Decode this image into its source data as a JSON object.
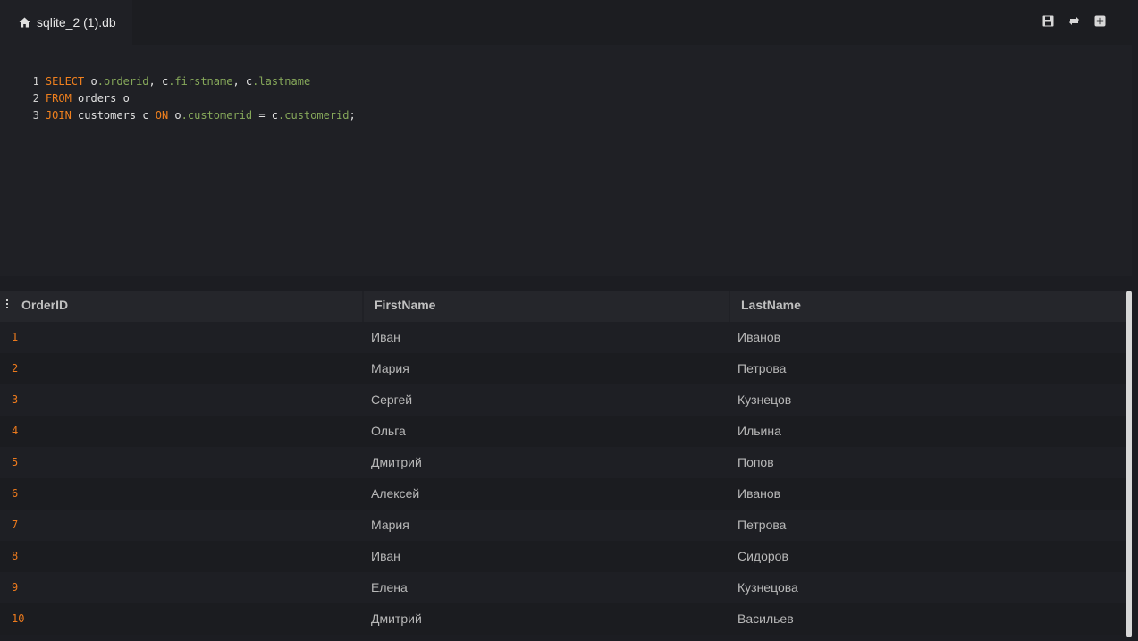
{
  "tab": {
    "label": "sqlite_2 (1).db",
    "icon": "home-icon"
  },
  "toolbar": {
    "icons": [
      "save-icon",
      "refresh-icon",
      "add-tab-icon"
    ]
  },
  "editor": {
    "lines": [
      {
        "num": "1",
        "tokens": [
          "SELECT",
          " o",
          ".orderid",
          ", c",
          ".firstname",
          ", c",
          ".lastname"
        ]
      },
      {
        "num": "2",
        "tokens": [
          "FROM",
          " orders o"
        ]
      },
      {
        "num": "3",
        "tokens": [
          "JOIN",
          " customers c ",
          "ON",
          " o",
          ".customerid",
          " = c",
          ".customerid",
          ";"
        ]
      }
    ]
  },
  "results": {
    "columns": [
      "OrderID",
      "FirstName",
      "LastName"
    ],
    "rows": [
      {
        "id": "1",
        "first": "Иван",
        "last": "Иванов"
      },
      {
        "id": "2",
        "first": "Мария",
        "last": "Петрова"
      },
      {
        "id": "3",
        "first": "Сергей",
        "last": "Кузнецов"
      },
      {
        "id": "4",
        "first": "Ольга",
        "last": "Ильина"
      },
      {
        "id": "5",
        "first": "Дмитрий",
        "last": "Попов"
      },
      {
        "id": "6",
        "first": "Алексей",
        "last": "Иванов"
      },
      {
        "id": "7",
        "first": "Мария",
        "last": "Петрова"
      },
      {
        "id": "8",
        "first": "Иван",
        "last": "Сидоров"
      },
      {
        "id": "9",
        "first": "Елена",
        "last": "Кузнецова"
      },
      {
        "id": "10",
        "first": "Дмитрий",
        "last": "Васильев"
      }
    ]
  },
  "colors": {
    "keyword": "#f0801e",
    "field": "#86a85a",
    "rownum": "#ec7a1d"
  }
}
